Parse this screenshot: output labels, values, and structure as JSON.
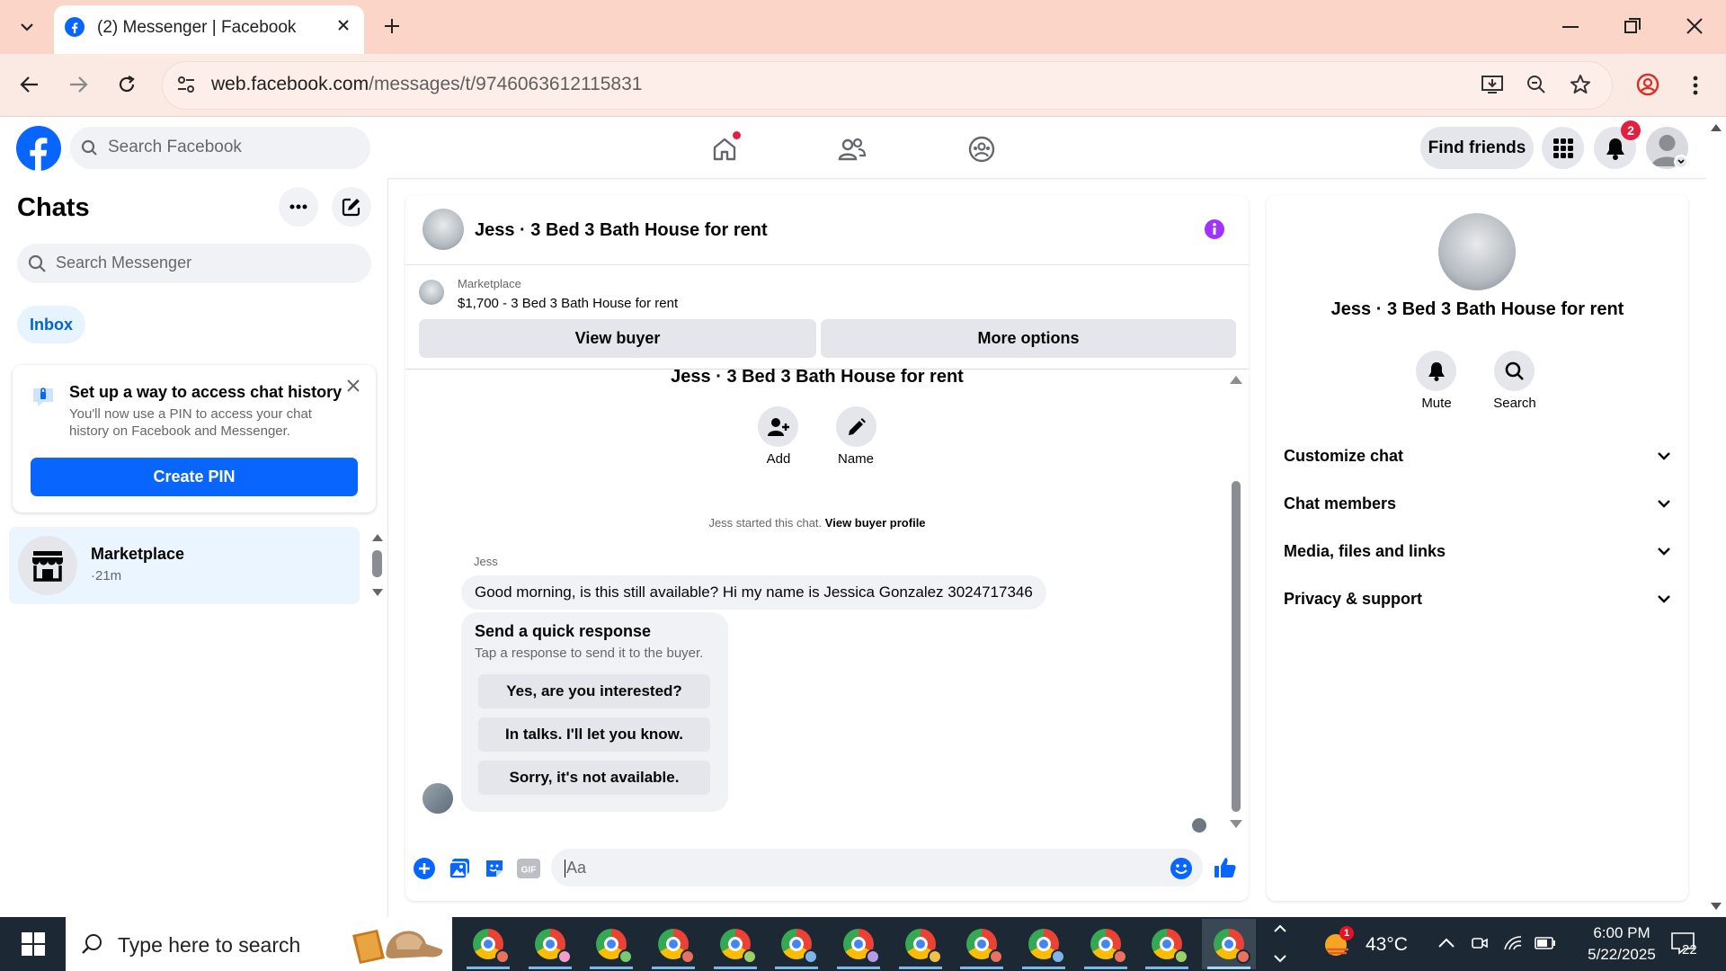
{
  "browser": {
    "tab_title": "(2) Messenger | Facebook",
    "url_host": "web.facebook.com",
    "url_path": "/messages/t/9746063612115831"
  },
  "fb_header": {
    "search_placeholder": "Search Facebook",
    "find_friends": "Find friends",
    "notification_count": "2"
  },
  "left": {
    "title": "Chats",
    "search_placeholder": "Search Messenger",
    "inbox_label": "Inbox",
    "pin_card": {
      "title": "Set up a way to access chat history",
      "description": "You'll now use a PIN to access your chat history on Facebook and Messenger.",
      "button": "Create PIN"
    },
    "conversations": [
      {
        "name": "Marketplace",
        "time": "·21m"
      }
    ]
  },
  "chat": {
    "header_title": "Jess · 3 Bed 3 Bath House for rent",
    "marketplace_label": "Marketplace",
    "listing": "$1,700 - 3 Bed 3 Bath House for rent",
    "view_buyer": "View buyer",
    "more_options": "More options",
    "conversation_title": "Jess · 3 Bed 3 Bath House for rent",
    "actions": {
      "add": "Add",
      "name": "Name"
    },
    "started_text": "Jess started this chat.",
    "view_buyer_profile": "View buyer profile",
    "sender": "Jess",
    "message": "Good morning, is this still available? Hi my name is Jessica Gonzalez  3024717346",
    "quick_response": {
      "title": "Send a quick response",
      "subtitle": "Tap a response to send it to the buyer.",
      "options": [
        "Yes, are you interested?",
        "In talks. I'll let you know.",
        "Sorry, it's not available."
      ]
    },
    "composer_placeholder": "Aa"
  },
  "info": {
    "name": "Jess · 3 Bed 3 Bath House for rent",
    "mute": "Mute",
    "search": "Search",
    "sections": [
      "Customize chat",
      "Chat members",
      "Media, files and links",
      "Privacy & support"
    ]
  },
  "taskbar": {
    "search_placeholder": "Type here to search",
    "weather_badge": "1",
    "temperature": "43°C",
    "time": "6:00 PM",
    "date": "5/22/2025",
    "notif_count": "22"
  },
  "colors": {
    "fb_blue": "#0866ff",
    "messenger_purple": "#a033ff",
    "tab_bar": "#fbd5c8",
    "taskbar": "#1c2833"
  },
  "icons": [
    "facebook-logo-icon",
    "search-icon",
    "home-icon",
    "friends-icon",
    "groups-icon",
    "menu-grid-icon",
    "bell-icon",
    "more-icon",
    "compose-icon",
    "close-icon",
    "shop-icon",
    "info-icon",
    "add-person-icon",
    "pencil-icon",
    "mute-bell-icon",
    "chevron-down-icon",
    "plus-circle-icon",
    "image-icon",
    "sticker-icon",
    "gif-icon",
    "emoji-icon",
    "like-icon",
    "chrome-icon",
    "windows-icon"
  ]
}
